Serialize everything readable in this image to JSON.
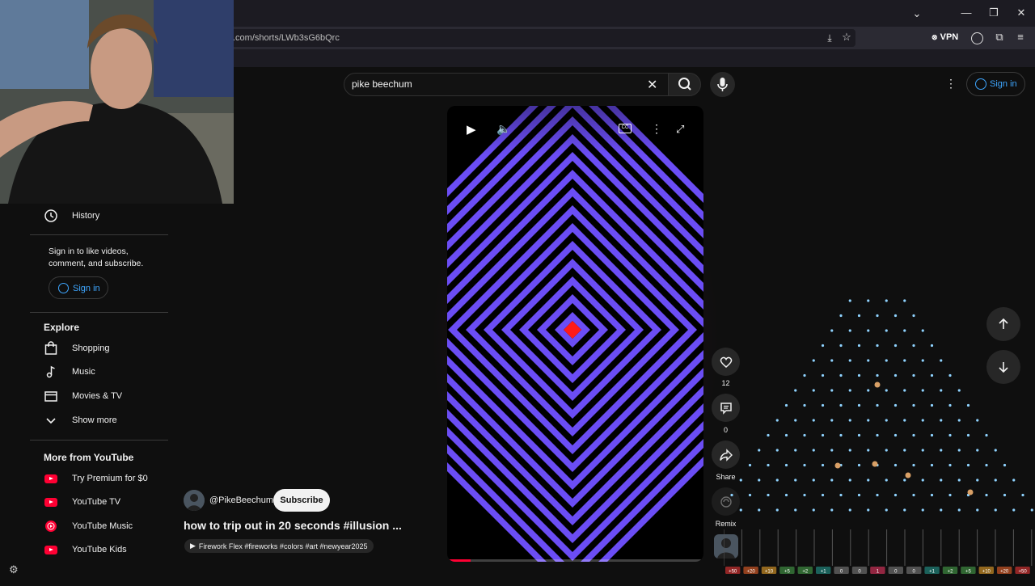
{
  "browser": {
    "url": ".com/shorts/LWb3sG6bQrc",
    "vpn_label": "VPN"
  },
  "header": {
    "search_value": "pike beechum",
    "signin_label": "Sign in"
  },
  "sidebar": {
    "history_label": "History",
    "signin_prompt_line1": "Sign in to like videos,",
    "signin_prompt_line2": "comment, and subscribe.",
    "signin_label": "Sign in",
    "explore_heading": "Explore",
    "explore_items": [
      {
        "label": "Shopping",
        "icon": "shopping-bag-icon"
      },
      {
        "label": "Music",
        "icon": "music-note-icon"
      },
      {
        "label": "Movies & TV",
        "icon": "clapperboard-icon"
      },
      {
        "label": "Show more",
        "icon": "chevron-down-icon"
      }
    ],
    "more_heading": "More from YouTube",
    "more_items": [
      {
        "label": "Try Premium for $0",
        "icon": "youtube-premium-icon"
      },
      {
        "label": "YouTube TV",
        "icon": "youtube-tv-icon"
      },
      {
        "label": "YouTube Music",
        "icon": "youtube-music-icon"
      },
      {
        "label": "YouTube Kids",
        "icon": "youtube-kids-icon"
      }
    ]
  },
  "video": {
    "channel": "@PikeBeechum",
    "subscribe_label": "Subscribe",
    "title": "how to trip out in 20 seconds #illusion ...",
    "music": "Firework Flex #fireworks #colors #art #newyear2025",
    "stripe_color": "#6b4df5",
    "center_color": "#ff1a1a",
    "progress_fraction": 0.09
  },
  "actions": {
    "likes": "12",
    "comments": "0",
    "share_label": "Share",
    "remix_label": "Remix"
  },
  "plinko": {
    "slot_values": [
      "+50",
      "+20",
      "+10",
      "+5",
      "+2",
      "+1",
      "0",
      "0",
      "1",
      "0",
      "0",
      "+1",
      "+2",
      "+5",
      "+10",
      "+20",
      "+50"
    ],
    "slot_colors": [
      "#ff3b3b",
      "#ff6a2b",
      "#ffb02b",
      "#4caf50",
      "#4caf50",
      "#26a69a",
      "#888888",
      "#888888",
      "#ff3b6b",
      "#888888",
      "#888888",
      "#26a69a",
      "#4caf50",
      "#4caf50",
      "#ffb02b",
      "#ff6a2b",
      "#ff3b3b"
    ],
    "peg_color": "#8fd3ff"
  }
}
